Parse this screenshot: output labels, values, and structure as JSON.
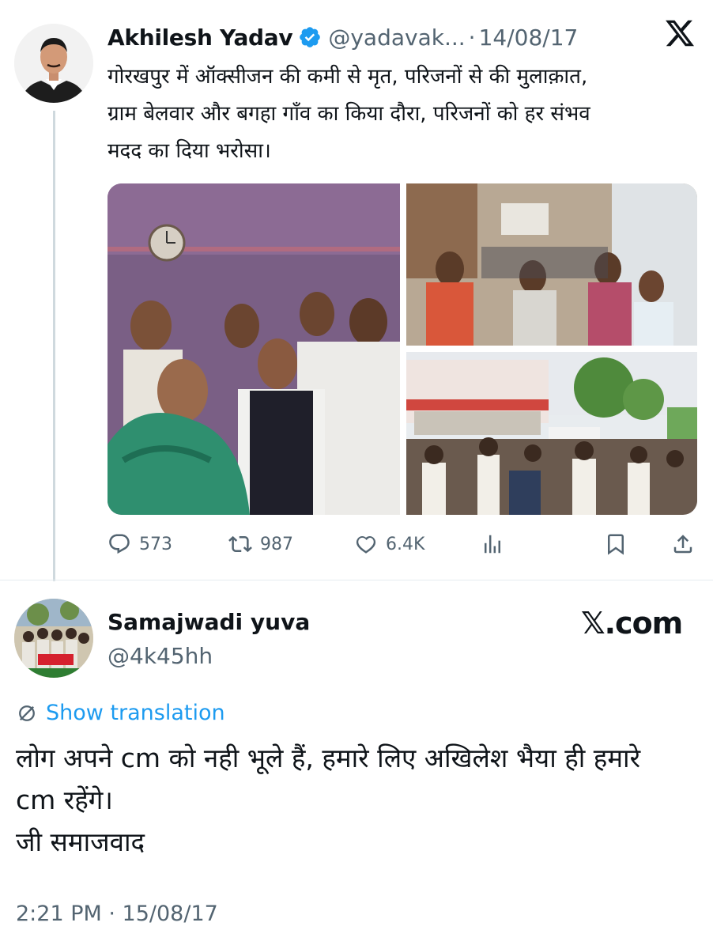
{
  "parent_tweet": {
    "author_name": "Akhilesh Yadav",
    "handle": "@yadavak...",
    "separator": "·",
    "date": "14/08/17",
    "text": "गोरखपुर में ऑक्सीजन की कमी से मृत, परिजनों से की मुलाक़ात,\nग्राम बेलवार और बगहा गाँव का किया दौरा, परिजनों को हर संभव\nमदद का दिया भरोसा।",
    "stats": {
      "replies": "573",
      "reposts": "987",
      "likes": "6.4K"
    },
    "icons": [
      "verified-badge-icon",
      "x-logo-icon",
      "reply-icon",
      "repost-icon",
      "like-icon",
      "views-icon",
      "bookmark-icon",
      "share-icon"
    ]
  },
  "reply_tweet": {
    "author_name": "Samajwadi yuva",
    "handle": "@4k45hh",
    "brand": "𝕏.com",
    "translate_label": "Show translation",
    "text": "लोग अपने cm को नही भूले हैं, हमारे लिए अखिलेश भैया ही हमारे\ncm रहेंगे।\nजी समाजवाद",
    "timestamp": "2:21 PM · 15/08/17"
  },
  "colors": {
    "text": "#0f1419",
    "secondary": "#536471",
    "accent": "#1d9bf0",
    "thread_line": "#cfd9de"
  }
}
